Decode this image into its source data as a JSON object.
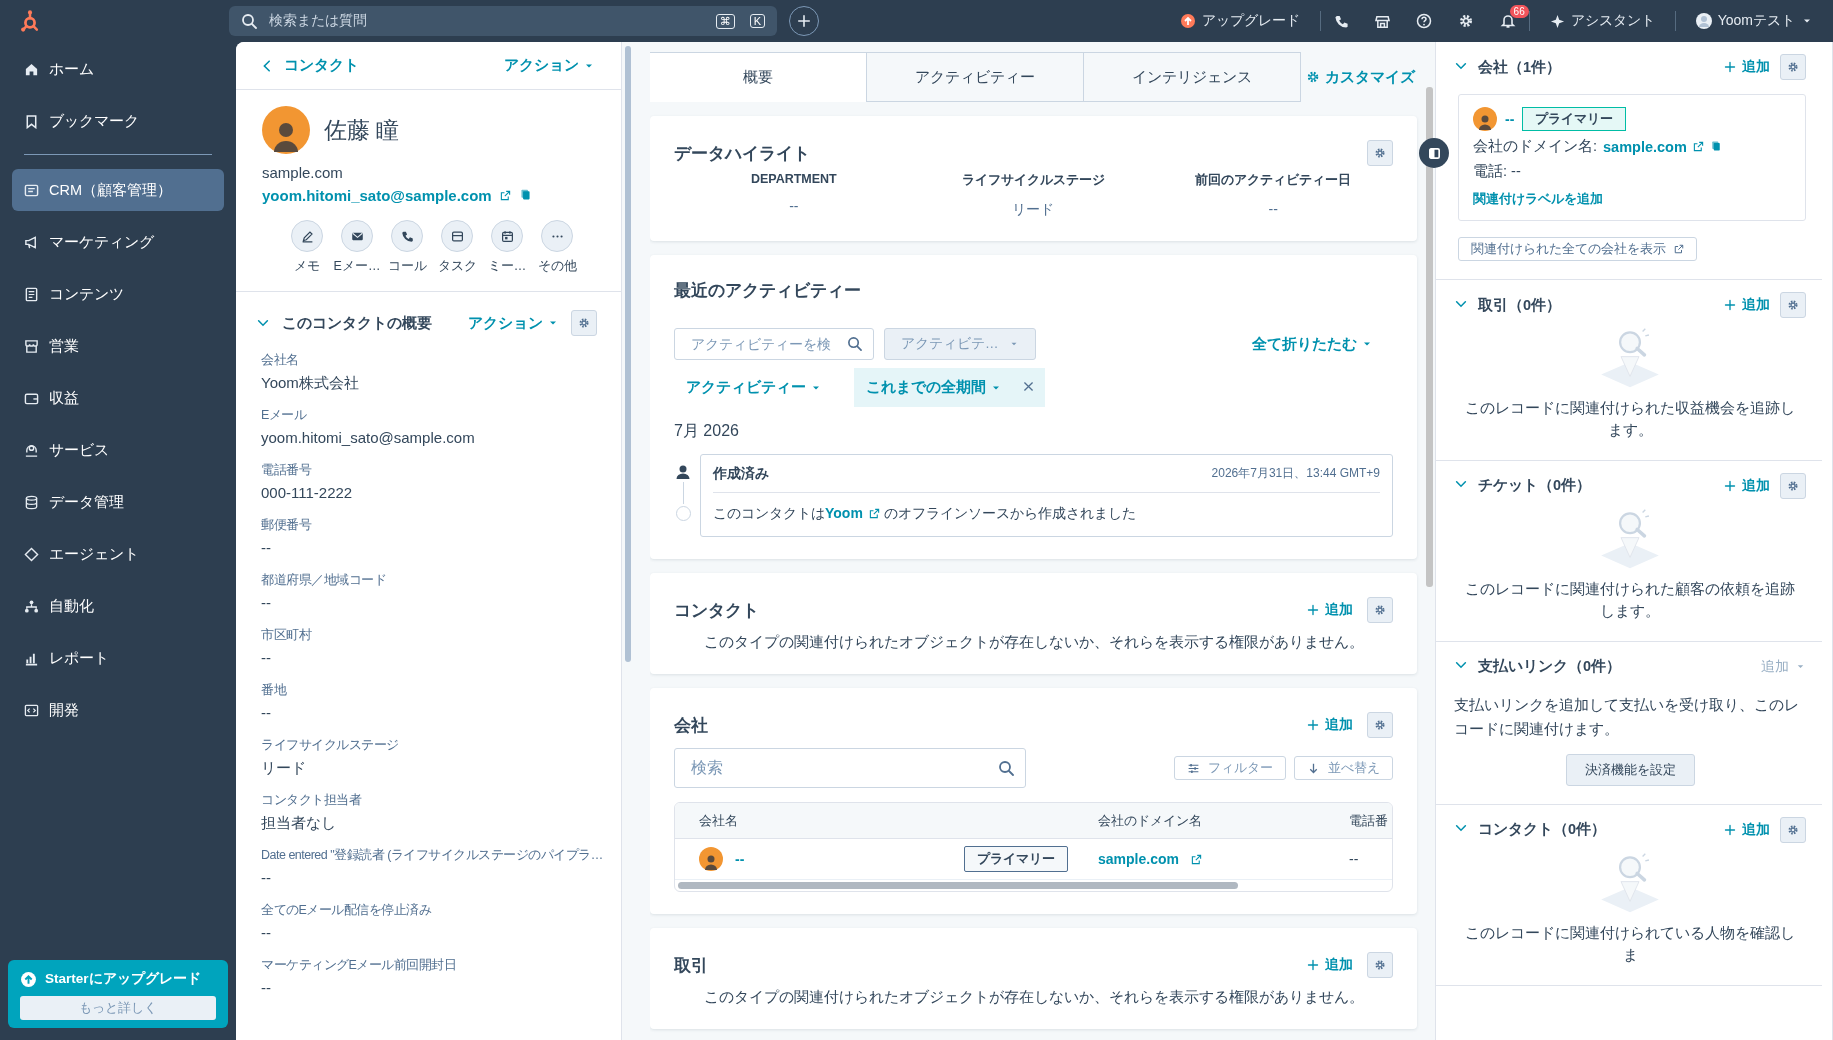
{
  "topbar": {
    "search": {
      "placeholder": "検索または質問",
      "keys": [
        "⌘",
        "K"
      ]
    },
    "upgrade": "アップグレード",
    "notifications": "66",
    "assistant": "アシスタント",
    "user": "Yoomテスト"
  },
  "nav": {
    "items": [
      {
        "label": "ホーム",
        "selected": false
      },
      {
        "label": "ブックマーク",
        "selected": false
      },
      {
        "label": "CRM（顧客管理）",
        "selected": true
      },
      {
        "label": "マーケティング",
        "selected": false
      },
      {
        "label": "コンテンツ",
        "selected": false
      },
      {
        "label": "営業",
        "selected": false
      },
      {
        "label": "収益",
        "selected": false
      },
      {
        "label": "サービス",
        "selected": false
      },
      {
        "label": "データ管理",
        "selected": false
      },
      {
        "label": "エージェント",
        "selected": false
      },
      {
        "label": "自動化",
        "selected": false
      },
      {
        "label": "レポート",
        "selected": false
      },
      {
        "label": "開発",
        "selected": false
      }
    ],
    "upgrade_card": {
      "title": "Starterにアップグレード",
      "button": "もっと詳しく"
    }
  },
  "contact": {
    "back": "コンタクト",
    "actions": "アクション",
    "name": "佐藤 瞳",
    "domain": "sample.com",
    "email": "yoom.hitomi_sato@sample.com",
    "quick_actions": [
      {
        "label": "メモ"
      },
      {
        "label": "Eメー…"
      },
      {
        "label": "コール"
      },
      {
        "label": "タスク"
      },
      {
        "label": "ミー…"
      },
      {
        "label": "その他"
      }
    ],
    "about": {
      "title": "このコンタクトの概要",
      "actions": "アクション",
      "fields": [
        {
          "label": "会社名",
          "value": "Yoom株式会社"
        },
        {
          "label": "Eメール",
          "value": "yoom.hitomi_sato@sample.com"
        },
        {
          "label": "電話番号",
          "value": "000-111-2222"
        },
        {
          "label": "郵便番号",
          "value": "--"
        },
        {
          "label": "都道府県／地域コード",
          "value": "--"
        },
        {
          "label": "市区町村",
          "value": "--"
        },
        {
          "label": "番地",
          "value": "--"
        },
        {
          "label": "ライフサイクルステージ",
          "value": "リード"
        },
        {
          "label": "コンタクト担当者",
          "value": "担当者なし"
        },
        {
          "label": "Date entered \"登録読者 (ライフサイクルステージのパイプラ…",
          "value": "--"
        },
        {
          "label": "全てのEメール配信を停止済み",
          "value": "--"
        },
        {
          "label": "マーケティングEメール前回開封日",
          "value": "--"
        }
      ]
    }
  },
  "middle": {
    "tabs": [
      {
        "label": "概要",
        "selected": true
      },
      {
        "label": "アクティビティー",
        "selected": false
      },
      {
        "label": "インテリジェンス",
        "selected": false
      }
    ],
    "customize": "カスタマイズ",
    "highlights": {
      "title": "データハイライト",
      "items": [
        {
          "label": "DEPARTMENT",
          "value": "--"
        },
        {
          "label": "ライフサイクルステージ",
          "value": "リード"
        },
        {
          "label": "前回のアクティビティー日",
          "value": "--"
        }
      ]
    },
    "activity": {
      "title": "最近のアクティビティー",
      "search_placeholder": "アクティビティーを検",
      "type_dropdown": "アクティビテ…",
      "collapse": "全て折りたたむ",
      "filters": [
        {
          "label": "アクティビティー",
          "active": false
        },
        {
          "label": "これまでの全期間",
          "active": true
        }
      ],
      "month": "7月 2026",
      "entries": [
        {
          "title": "作成済み",
          "time": "2026年7月31日、13:44 GMT+9",
          "text_before": "このコンタクトは",
          "link": "Yoom",
          "text_after": "のオフラインソースから作成されました"
        }
      ]
    },
    "contacts": {
      "title": "コンタクト",
      "add": "追加",
      "message": "このタイプの関連付けられたオブジェクトが存在しないか、それらを表示する権限がありません。"
    },
    "companies": {
      "title": "会社",
      "add": "追加",
      "search_placeholder": "検索",
      "filter": "フィルター",
      "sort": "並べ替え",
      "columns": [
        "会社名",
        "会社のドメイン名",
        "電話番"
      ],
      "rows": [
        {
          "name": "--",
          "badge": "プライマリー",
          "domain": "sample.com",
          "phone": "--"
        }
      ]
    },
    "deals": {
      "title": "取引",
      "add": "追加",
      "message": "このタイプの関連付けられたオブジェクトが存在しないか、それらを表示する権限がありません。"
    }
  },
  "sidebar": {
    "sections": [
      {
        "kind": "company",
        "title": "会社（1件）",
        "add": "追加",
        "add_disabled": false,
        "card": {
          "name": "--",
          "badge": "プライマリー",
          "domain_label": "会社のドメイン名:",
          "domain": "sample.com",
          "phone": "電話: --",
          "label_link": "関連付けラベルを追加"
        },
        "view_all": "関連付けられた全ての会社を表示"
      },
      {
        "kind": "empty",
        "title": "取引（0件）",
        "add": "追加",
        "add_disabled": false,
        "message": "このレコードに関連付けられた収益機会を追跡します。"
      },
      {
        "kind": "empty",
        "title": "チケット（0件）",
        "add": "追加",
        "add_disabled": false,
        "message": "このレコードに関連付けられた顧客の依頼を追跡します。"
      },
      {
        "kind": "payment",
        "title": "支払いリンク（0件）",
        "add": "追加",
        "add_disabled": true,
        "message": "支払いリンクを追加して支払いを受け取り、このレコードに関連付けます。",
        "button": "決済機能を設定"
      },
      {
        "kind": "empty",
        "title": "コンタクト（0件）",
        "add": "追加",
        "add_disabled": false,
        "message": "このレコードに関連付けられている人物を確認しま"
      }
    ]
  }
}
